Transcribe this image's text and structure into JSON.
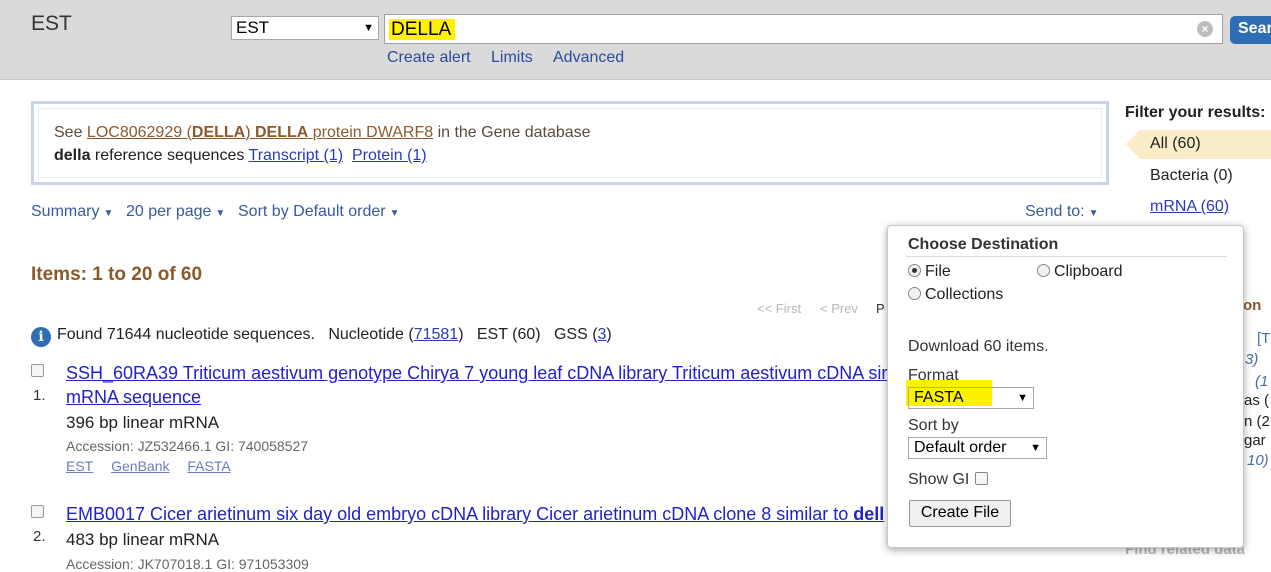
{
  "header": {
    "db_title": "EST",
    "db_select": "EST",
    "search_value": "DELLA",
    "search_button": "Sear",
    "create_alert": "Create alert",
    "limits": "Limits",
    "advanced": "Advanced",
    "highlight_color": "#fff200"
  },
  "message": {
    "see": "See",
    "loc_link": "LOC8062929",
    "paren_open": "(",
    "della1": "DELLA",
    "paren_close": ")",
    "della2": "DELLA",
    "protein_dwarf": "protein DWARF8",
    "gene_db": "in the Gene database",
    "bold_della": "della",
    "ref_seqs": "reference sequences",
    "transcript": "Transcript (1)",
    "protein": "Protein (1)"
  },
  "display_bar": {
    "summary": "Summary",
    "per_page": "20 per page",
    "sort": "Sort by Default order",
    "send_to": "Send to:"
  },
  "items_title": "Items: 1 to 20 of 60",
  "pager": {
    "first": "<< First",
    "prev": "< Prev",
    "partial": "P"
  },
  "found": {
    "text": "Found 71644 nucleotide sequences.",
    "nucleotide_label": "Nucleotide (",
    "nucleotide_count": "71581",
    "nucleotide_close": ")",
    "est": "EST (60)",
    "gss_label": "GSS (",
    "gss_count": "3",
    "gss_close": ")"
  },
  "results": [
    {
      "num": "1.",
      "title_line1": "SSH_60RA39 Triticum aestivum genotype Chirya 7 young leaf cDNA library Triticum aestivum cDNA sir",
      "title_line2": "mRNA sequence",
      "desc": "396 bp linear mRNA",
      "accession": "Accession: JZ532466.1   GI: 740058527",
      "links": [
        "EST",
        "GenBank",
        "FASTA"
      ]
    },
    {
      "num": "2.",
      "title_line1": "EMB0017 Cicer arietinum six day old embryo cDNA library Cicer arietinum cDNA clone 8 similar to ",
      "title_bold": "dell",
      "desc": "483 bp linear mRNA",
      "accession": "Accession: JK707018.1   GI: 971053309"
    }
  ],
  "filters": {
    "title": "Filter your results:",
    "all": "All (60)",
    "bacteria": "Bacteria (0)",
    "mrna": "mRNA (60)",
    "peek": [
      "on",
      "[T",
      "3)",
      "(1",
      "as (",
      "n (2",
      "gar",
      "10)"
    ]
  },
  "send_popup": {
    "title": "Choose Destination",
    "file": "File",
    "clipboard": "Clipboard",
    "collections": "Collections",
    "download": "Download 60 items.",
    "format_label": "Format",
    "format_value": "FASTA",
    "sortby_label": "Sort by",
    "sortby_value": "Default order",
    "show_gi": "Show GI",
    "create_file": "Create File"
  },
  "find_related": "Find related data"
}
